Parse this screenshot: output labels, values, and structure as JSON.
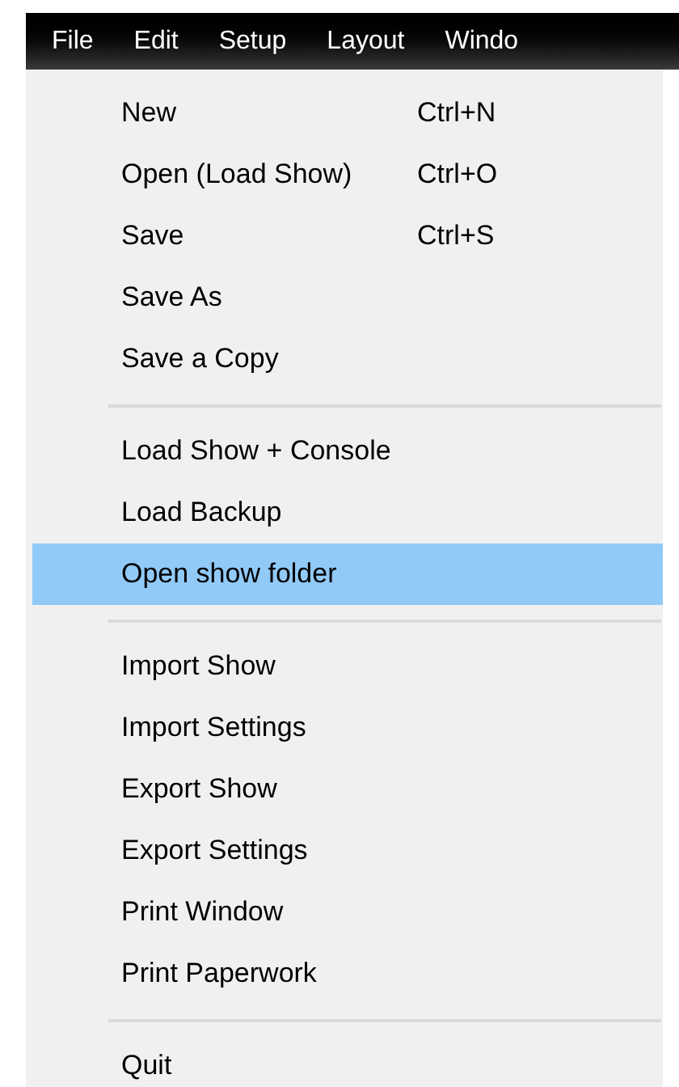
{
  "menu_bar": [
    {
      "label": "File"
    },
    {
      "label": "Edit"
    },
    {
      "label": "Setup"
    },
    {
      "label": "Layout"
    },
    {
      "label": "Windo"
    }
  ],
  "menu": {
    "groups": [
      [
        {
          "label": "New",
          "shortcut": "Ctrl+N",
          "selected": false
        },
        {
          "label": "Open (Load Show)",
          "shortcut": "Ctrl+O",
          "selected": false
        },
        {
          "label": "Save",
          "shortcut": "Ctrl+S",
          "selected": false
        },
        {
          "label": "Save As",
          "selected": false
        },
        {
          "label": "Save a Copy",
          "selected": false
        }
      ],
      [
        {
          "label": "Load Show + Console",
          "selected": false
        },
        {
          "label": "Load Backup",
          "selected": false
        },
        {
          "label": "Open show folder",
          "selected": true
        }
      ],
      [
        {
          "label": "Import Show",
          "selected": false
        },
        {
          "label": "Import Settings",
          "selected": false
        },
        {
          "label": "Export Show",
          "selected": false
        },
        {
          "label": "Export Settings",
          "selected": false
        },
        {
          "label": "Print Window",
          "selected": false
        },
        {
          "label": "Print Paperwork",
          "selected": false
        }
      ],
      [
        {
          "label": "Quit",
          "selected": false
        }
      ]
    ]
  }
}
